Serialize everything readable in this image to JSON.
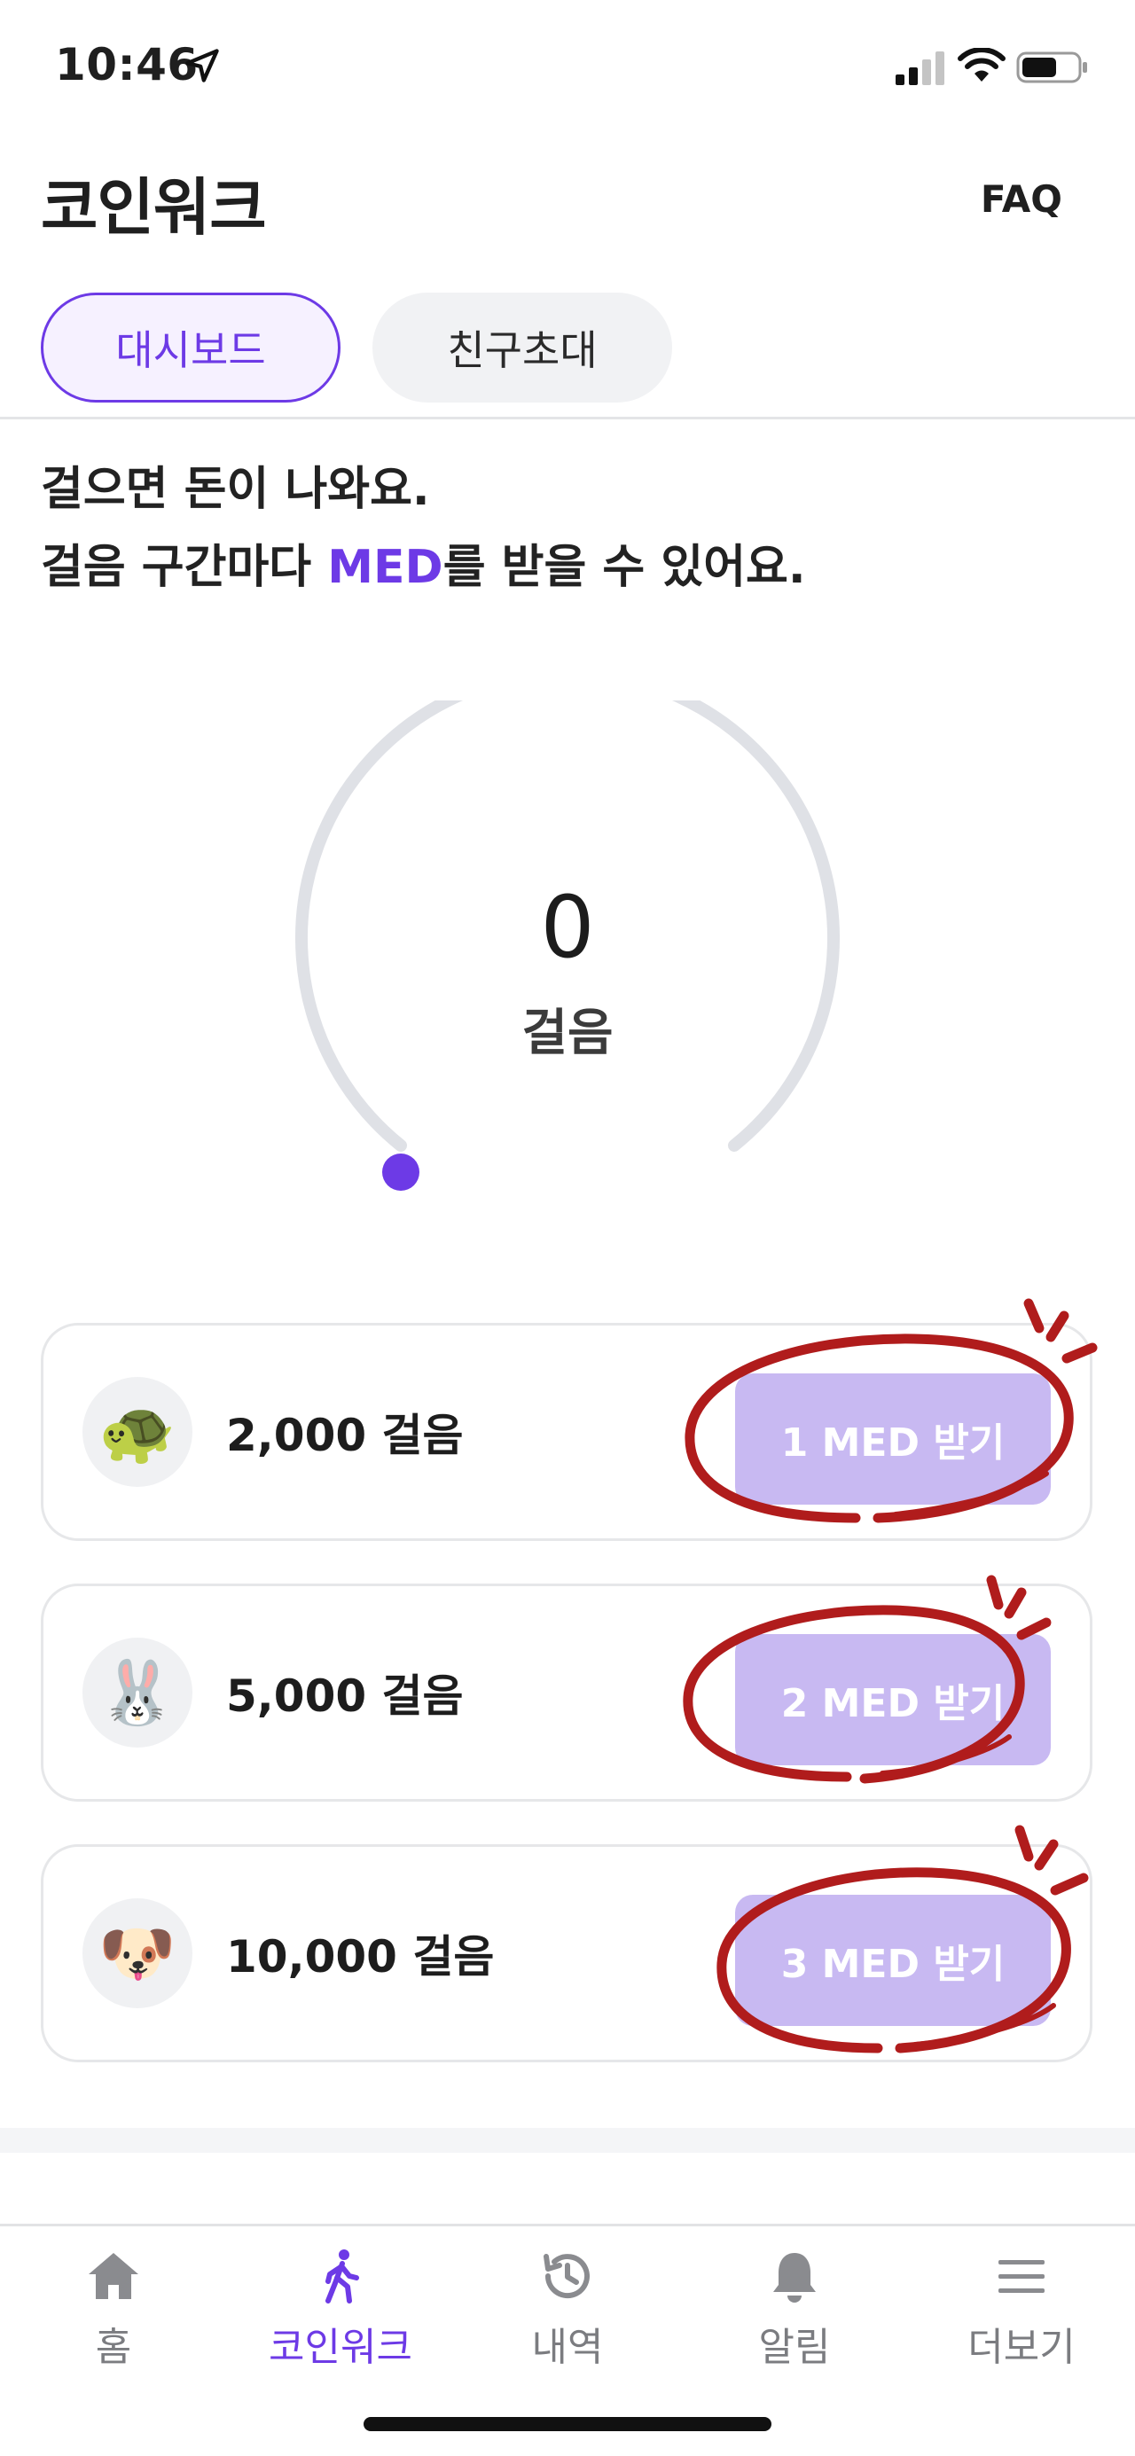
{
  "status_bar": {
    "time": "10:46"
  },
  "header": {
    "title": "코인워크",
    "faq_label": "FAQ"
  },
  "tabs": [
    {
      "label": "대시보드",
      "active": true
    },
    {
      "label": "친구초대",
      "active": false
    }
  ],
  "headline": {
    "line1": "걸으면 돈이 나와요.",
    "line2_prefix": "걸음 구간마다 ",
    "line2_accent": "MED",
    "line2_suffix": "를 받을 수 있어요."
  },
  "gauge": {
    "value": "0",
    "unit": "걸음",
    "progress": 0
  },
  "rewards": [
    {
      "icon": "🐢",
      "icon_name": "turtle-icon",
      "steps_label": "2,000 걸음",
      "button_label": "1 MED 받기"
    },
    {
      "icon": "🐰",
      "icon_name": "rabbit-icon",
      "steps_label": "5,000 걸음",
      "button_label": "2 MED 받기"
    },
    {
      "icon": "🐶",
      "icon_name": "dog-icon",
      "steps_label": "10,000 걸음",
      "button_label": "3 MED 받기"
    }
  ],
  "bottom_nav": [
    {
      "label": "홈",
      "icon": "home-icon",
      "active": false
    },
    {
      "label": "코인워크",
      "icon": "walking-icon",
      "active": true
    },
    {
      "label": "내역",
      "icon": "history-icon",
      "active": false
    },
    {
      "label": "알림",
      "icon": "bell-icon",
      "active": false
    },
    {
      "label": "더보기",
      "icon": "menu-icon",
      "active": false
    }
  ],
  "colors": {
    "accent": "#6d3ae6",
    "button_bg": "#c8b9f2",
    "gauge_track": "#dfe1e6",
    "annotation": "#b01c1c"
  }
}
